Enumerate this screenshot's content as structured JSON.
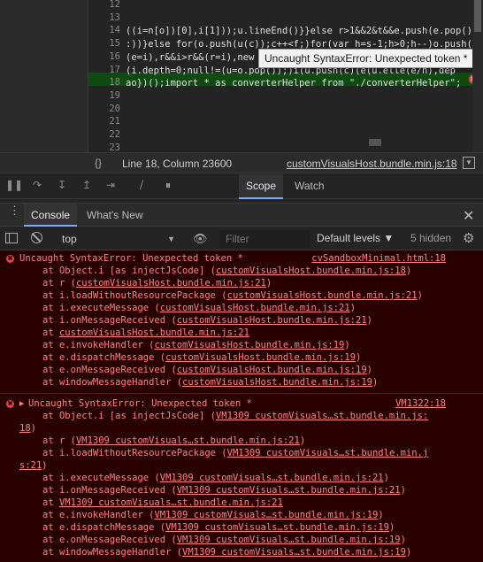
{
  "editor": {
    "line_numbers": [
      "12",
      "13",
      "14",
      "15",
      "16",
      "17",
      "18",
      "19",
      "20",
      "21",
      "22",
      "23"
    ],
    "code_lines": [
      "",
      "",
      "((i=n[o])[0],i[1]));u.lineEnd()}}else r>1&&2&t&&e.push(e.pop().",
      ":))}else for(o.push(u(c));c++<f;)for(var h=s-1;h>0;h--)o.push(",
      "(e=i),r&&i>r&&(r=i),new",
      "(i.depth=0;null!=(u=o.pop());)i(u.push(c)(e(u.elle(e/h),dep",
      "ao})();import * as converterHelper from \"./converterHelper\";",
      "",
      "",
      "",
      "",
      ""
    ],
    "error_tooltip": "Uncaught SyntaxError: Unexpected token *",
    "error_badge": "✖"
  },
  "statusbar": {
    "braces": "{}",
    "cursor_position": "Line 18, Column 23600",
    "source_file": "customVisualsHost.bundle.min.js:18"
  },
  "debugger": {
    "tabs": [
      "Scope",
      "Watch"
    ]
  },
  "drawer": {
    "tabs": [
      "Console",
      "What's New"
    ],
    "close": "✕"
  },
  "console_toolbar": {
    "context": "top",
    "filter_placeholder": "Filter",
    "levels": "Default levels ▼",
    "hidden": "5 hidden"
  },
  "messages": [
    {
      "title": "Uncaught SyntaxError: Unexpected token *",
      "source": "cvSandboxMinimal.html:18",
      "stack": [
        {
          "prefix": "at Object.i [as injectJsCode] (",
          "link": "customVisualsHost.bundle.min.js:18",
          "suffix": ")"
        },
        {
          "prefix": "at r (",
          "link": "customVisualsHost.bundle.min.js:21",
          "suffix": ")"
        },
        {
          "prefix": "at i.loadWithoutResourcePackage (",
          "link": "customVisualsHost.bundle.min.js:21",
          "suffix": ")"
        },
        {
          "prefix": "at i.executeMessage (",
          "link": "customVisualsHost.bundle.min.js:21",
          "suffix": ")"
        },
        {
          "prefix": "at i.onMessageReceived (",
          "link": "customVisualsHost.bundle.min.js:21",
          "suffix": ")"
        },
        {
          "prefix": "at ",
          "link": "customVisualsHost.bundle.min.js:21",
          "suffix": ""
        },
        {
          "prefix": "at e.invokeHandler (",
          "link": "customVisualsHost.bundle.min.js:19",
          "suffix": ")"
        },
        {
          "prefix": "at e.dispatchMessage (",
          "link": "customVisualsHost.bundle.min.js:19",
          "suffix": ")"
        },
        {
          "prefix": "at e.onMessageReceived (",
          "link": "customVisualsHost.bundle.min.js:19",
          "suffix": ")"
        },
        {
          "prefix": "at windowMessageHandler (",
          "link": "customVisualsHost.bundle.min.js:19",
          "suffix": ")"
        }
      ]
    },
    {
      "title": "Uncaught SyntaxError: Unexpected token *",
      "source": "VM1322:18",
      "stack": [
        {
          "prefix": "at Object.i [as injectJsCode] (",
          "link": "VM1309 customVisuals…st.bundle.min.js:",
          "suffix": ""
        },
        {
          "prefix": "",
          "link": "18",
          "suffix": ")"
        },
        {
          "prefix": "at r (",
          "link": "VM1309 customVisuals…st.bundle.min.js:21",
          "suffix": ")"
        },
        {
          "prefix": "at i.loadWithoutResourcePackage (",
          "link": "VM1309 customVisuals…st.bundle.min.j",
          "suffix": ""
        },
        {
          "prefix": "",
          "link": "s:21",
          "suffix": ")"
        },
        {
          "prefix": "at i.executeMessage (",
          "link": "VM1309 customVisuals…st.bundle.min.js:21",
          "suffix": ")"
        },
        {
          "prefix": "at i.onMessageReceived (",
          "link": "VM1309 customVisuals…st.bundle.min.js:21",
          "suffix": ")"
        },
        {
          "prefix": "at ",
          "link": "VM1309 customVisuals…st.bundle.min.js:21",
          "suffix": ""
        },
        {
          "prefix": "at e.invokeHandler (",
          "link": "VM1309 customVisuals…st.bundle.min.js:19",
          "suffix": ")"
        },
        {
          "prefix": "at e.dispatchMessage (",
          "link": "VM1309 customVisuals…st.bundle.min.js:19",
          "suffix": ")"
        },
        {
          "prefix": "at e.onMessageReceived (",
          "link": "VM1309 customVisuals…st.bundle.min.js:19",
          "suffix": ")"
        },
        {
          "prefix": "at windowMessageHandler (",
          "link": "VM1309 customVisuals…st.bundle.min.js:19",
          "suffix": ")"
        }
      ]
    }
  ],
  "colors": {
    "error_bg": "#290000",
    "error_text": "#ff8080",
    "highlight_line": "#0f4a10",
    "accent_tab": "#7cacf8"
  }
}
